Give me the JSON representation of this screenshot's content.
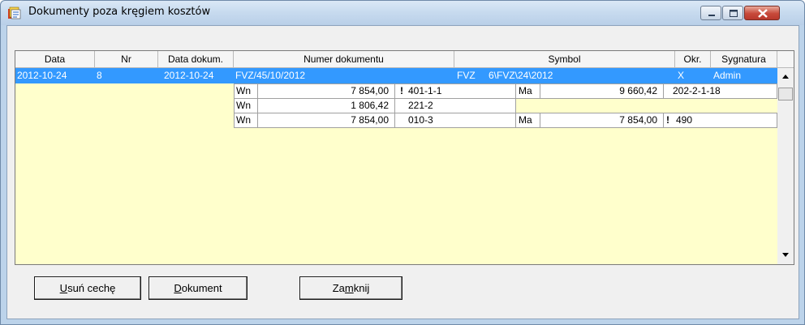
{
  "window": {
    "title": "Dokumenty poza kręgiem kosztów",
    "icons": {
      "app": "documents-app-icon",
      "minimize": "minimize-icon",
      "maximize": "maximize-icon",
      "close": "close-icon"
    }
  },
  "grid": {
    "headers": [
      "Data",
      "Nr",
      "Data dokum.",
      "Numer dokumentu",
      "Symbol",
      "Okr.",
      "Sygnatura"
    ],
    "selected_row": {
      "data": "2012-10-24",
      "nr": "8",
      "data_dokum": "2012-10-24",
      "numer_dokumentu": "FVZ/45/10/2012",
      "symbol_prefix": "FVZ",
      "symbol": "6\\FVZ\\24\\2012",
      "okr": "X",
      "sygnatura": "Admin"
    },
    "postings": [
      {
        "side": "Wn",
        "amount": "7 854,00",
        "flag": "!",
        "account": "401-1-1",
        "ma_side": "Ma",
        "ma_amount": "9 660,42",
        "ma_flag": "",
        "ma_account": "202-2-1-18"
      },
      {
        "side": "Wn",
        "amount": "1 806,42",
        "flag": "",
        "account": "221-2",
        "ma_side": "",
        "ma_amount": "",
        "ma_flag": "",
        "ma_account": ""
      },
      {
        "side": "Wn",
        "amount": "7 854,00",
        "flag": "",
        "account": "010-3",
        "ma_side": "Ma",
        "ma_amount": "7 854,00",
        "ma_flag": "!",
        "ma_account": "490"
      }
    ]
  },
  "buttons": {
    "remove_feature": {
      "hotkey": "U",
      "rest": "suń cechę"
    },
    "document": {
      "hotkey": "D",
      "rest": "okument"
    },
    "close": {
      "pre": "Za",
      "hotkey": "m",
      "post": "knij"
    }
  },
  "colors": {
    "selection": "#3399ff",
    "grid_bg": "#ffffcc"
  }
}
